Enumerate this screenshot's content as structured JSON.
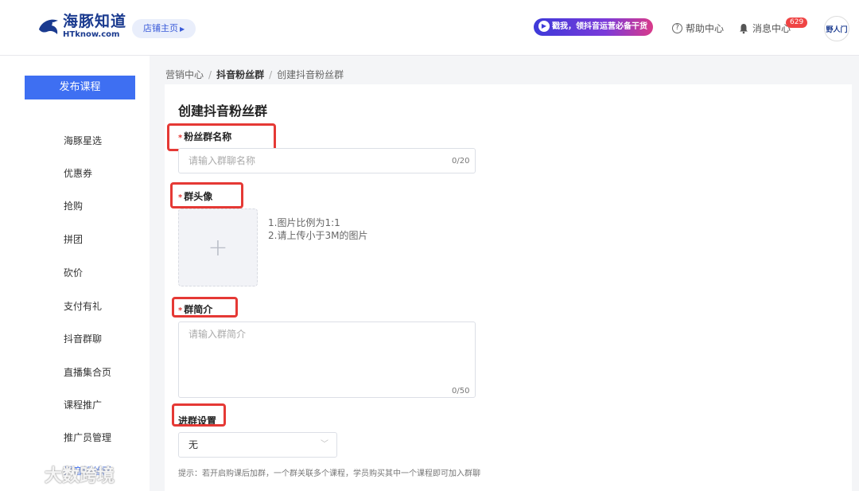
{
  "header": {
    "logo_cn": "海豚知道",
    "logo_en": "HTknow.com",
    "shop_home": "店铺主页",
    "promo": "戳我，领抖音运营必备干货",
    "help": "帮助中心",
    "messages": "消息中心",
    "message_count": "629",
    "avatar_text": "野人门"
  },
  "sidebar": {
    "publish_label": "发布课程",
    "items": [
      {
        "label": "海豚星选"
      },
      {
        "label": "优惠券"
      },
      {
        "label": "抢购"
      },
      {
        "label": "拼团"
      },
      {
        "label": "砍价"
      },
      {
        "label": "支付有礼"
      },
      {
        "label": "抖音群聊"
      },
      {
        "label": "直播集合页"
      },
      {
        "label": "课程推广"
      },
      {
        "label": "推广员管理"
      },
      {
        "label": "抖音粉丝群"
      }
    ]
  },
  "breadcrumb": {
    "items": [
      "营销中心",
      "抖音粉丝群",
      "创建抖音粉丝群"
    ],
    "sep": "/"
  },
  "form": {
    "title": "创建抖音粉丝群",
    "required_mark": "*",
    "name_label": "粉丝群名称",
    "name_placeholder": "请输入群聊名称",
    "name_counter": "0/20",
    "avatar_label": "群头像",
    "avatar_plus": "+",
    "avatar_hint1": "1.图片比例为1:1",
    "avatar_hint2": "2.请上传小于3M的图片",
    "intro_label": "群简介",
    "intro_placeholder": "请输入群简介",
    "intro_counter": "0/50",
    "join_label": "进群设置",
    "join_value": "无",
    "tip": "提示：若开启购课后加群，一个群关联多个课程，学员购买其中一个课程即可加入群聊"
  },
  "watermark": {
    "text": "大数跨境"
  },
  "colors": {
    "accent": "#3e6ff2",
    "highlight": "#e53935",
    "brand": "#1a3a8f"
  }
}
